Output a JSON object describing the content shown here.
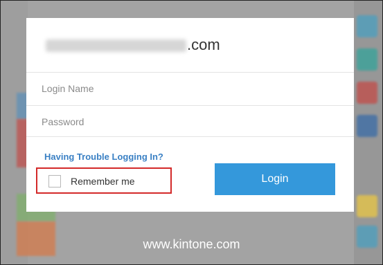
{
  "dialog": {
    "domain_suffix": ".com",
    "login_name_placeholder": "Login Name",
    "password_placeholder": "Password",
    "trouble_link": "Having Trouble Logging In?",
    "remember_label": "Remember me",
    "remember_checked": false,
    "login_button": "Login"
  },
  "footer": {
    "site": "www.kintone.com"
  },
  "colors": {
    "login_button": "#3498db",
    "link": "#3a80c4",
    "highlight_border": "#d32929"
  }
}
